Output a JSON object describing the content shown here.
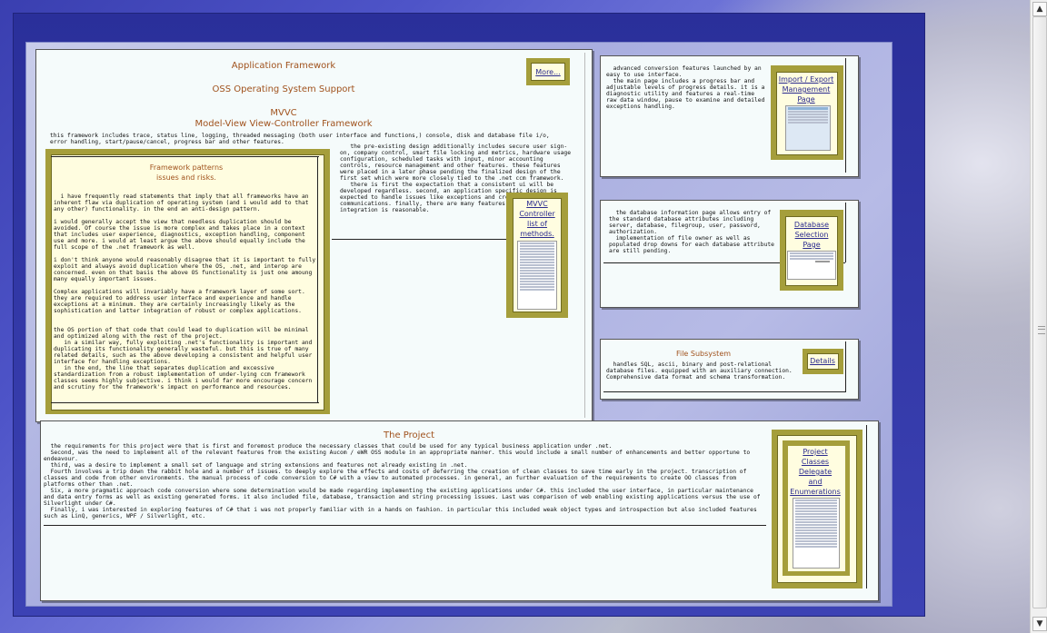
{
  "framework": {
    "title1": "Application Framework",
    "title2": "OSS Operating System Support",
    "title3": "MVVC",
    "title4": "Model-View View-Controller Framework",
    "desc": "this framework includes trace, status line, logging, threaded messaging (both user interface and functions,) console, disk and database file i/o, error handling, start/pause/cancel, progress bar and other features.",
    "design_text": "   the pre-existing design additionally includes secure user sign-on, company control, smart file locking and metrics, hardware usage configuration, scheduled tasks with input, minor accounting controls, resource management and other features. these features were placed in a later phase pending the finalized design of the first set which were more closely tied to the .net ccm framework.\n   there is first the expectation that a consistent ui will be developed regardless. second, an application specific design is expected to handle issues like exceptions and cross thread communications. finally, there are many features so pervasive that integration is reasonable.",
    "more_link": "More...",
    "mvvc_link": [
      "MVVC",
      "Controller",
      "list of",
      "methods."
    ]
  },
  "patterns": {
    "title1": "Framework patterns",
    "title2": "issues and risks.",
    "p1": "  i have frequently read statements that imply that all frameworks have an inherent flaw via duplication of operating system (and i would add to that any other) functionality. in the end an anti-design pattern.",
    "p2": "i would generally accept the view that needless duplication should be avoided. Of course the issue is more complex and takes place in a context that includes user experience, diagnostics, exception handling, component use and more. i would at least argue the above should equally include the full scope of the .net framework as well.",
    "p3": "i don't think anyone would reasonably disagree that it is important to fully exploit and always avoid duplication where the OS, .net, and interop are concerned. even on that basis the above OS functionality is just one amoung many equally important issues.",
    "p4": "Complex applications will invariably have a framework layer of some sort. they are required to address user interface and experience and handle exceptions at a minimum. they are certainly increasingly likely as the sophistication and latter integration of robust or complex applications.",
    "p5": "the OS portion of that code that could lead to duplication will be minimal and optimized along with the rest of the project.\n   in a similar way, fully exploiting .net's functionality is important and duplicating its functionality generally wasteful. but this is true of many related details, such as the above developing a consistent and helpful user interface for handling exceptions.\n   in the end, the line that separates duplication and excessive standardization from a robust implementation of under-lying ccm framework classes seems highly subjective. i think i would far more encourage concern and scrutiny for the framework's impact on performance and resources."
  },
  "conversion": {
    "text": "  advanced conversion features launched by an easy to use interface.\n  the main page includes a progress bar and adjustable levels of progress details. it is a diagnostic utility and features a real-time raw data window, pause to examine and detailed exceptions handling.",
    "link": [
      "Import / Export",
      "Management",
      "Page"
    ]
  },
  "database": {
    "text": "  the database information page allows entry of the standard database attributes including server, database, filegroup, user, password, authorization.\n  implementation of file owner as well as populated drop downs for each database attribute are still pending.",
    "link": [
      "Database",
      "Selection",
      "Page"
    ]
  },
  "filesub": {
    "title": "File Subsystem",
    "text": "  handles SQL, ascii, binary and post-relational database files. equipped with an auxiliary connection. Comprehensive data format and schema transformation.",
    "link": "Details"
  },
  "project": {
    "title": "The Project",
    "text": "  the requirements for this project were that is first and foremost produce the necessary classes that could be used for any typical business application under .net.\n  Second, was the need to implement all of the relevant features from the existing Aucom / eWR OSS module in an appropriate manner. this would include a small number of enhancements and better opportune to endeavour.\n  third, was a desire to implement a small set of language and string extensions and features not already existing in .net.\n  Fourth involves a trip down the rabbit hole and a number of issues. to deeply explore the effects and costs of deferring the creation of clean classes to save time early in the project. transcription of classes and code from other environments. the manual process of code conversion to C# with a view to automated processes. in general, an further evaluation of the requirements to create OO classes from platforms other than .net.\n  Six, a more pragmatic approach code conversion where some determination would be made regarding implementing the existing applications under C#. this included the user interface, in particular maintenance and data entry forms as well as existing generated forms. it also included file, database, transaction and string processing issues. Last was comparison of web enabling existing applications versus the use of Silverlight under C#.\n  Finally, i was interested in exploring features of C# that i was not properly familiar with in a hands on fashion. in particular this included weak object types and introspection but also included features such as LinQ, generics, WPF / Silverlight, etc.",
    "link": [
      "Project",
      "Classes",
      "Delegate",
      "and",
      "Enumerations"
    ]
  },
  "scrollbar": {
    "up": "▲",
    "down": "▼"
  }
}
